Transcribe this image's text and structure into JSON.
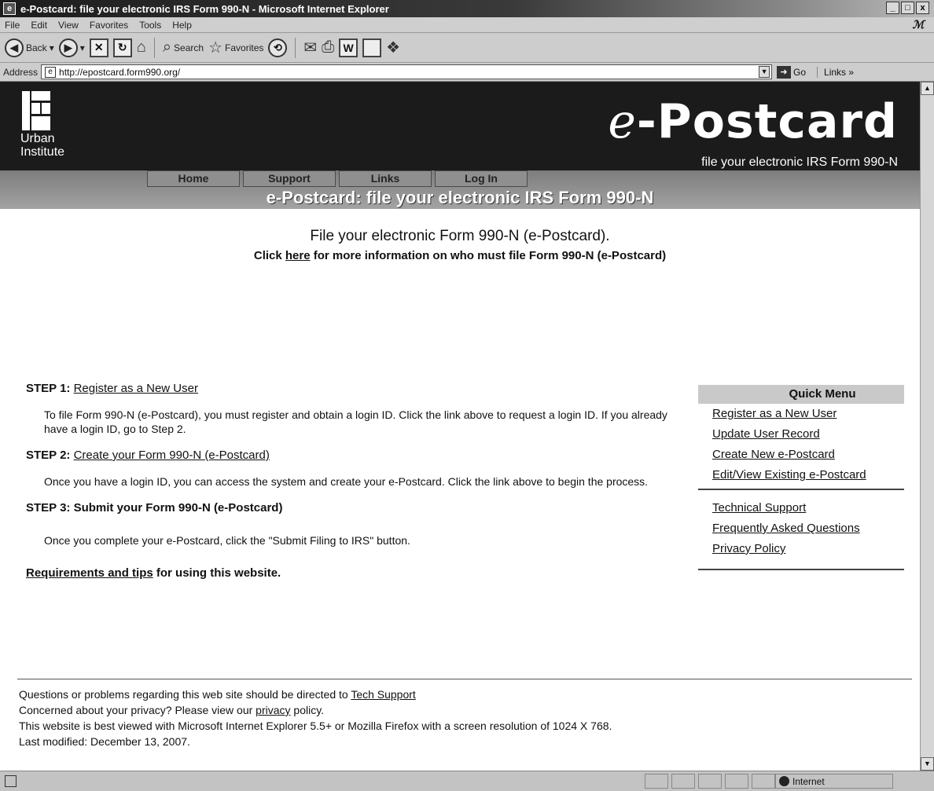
{
  "window": {
    "title": "e-Postcard: file your electronic IRS Form 990-N - Microsoft Internet Explorer",
    "controls": [
      "_",
      "□",
      "x"
    ]
  },
  "menubar": [
    "File",
    "Edit",
    "View",
    "Favorites",
    "Tools",
    "Help"
  ],
  "toolbar": {
    "back_label": "Back",
    "search_label": "Search",
    "favorites_label": "Favorites"
  },
  "addressbar": {
    "label": "Address",
    "url": "http://epostcard.form990.org/",
    "go_label": "Go",
    "links_label": "Links"
  },
  "banner": {
    "org_name_line1": "Urban",
    "org_name_line2": "Institute",
    "brand_e": "e",
    "brand_rest": "-Postcard",
    "brand_subtitle": "file your electronic IRS Form 990-N",
    "nav": [
      "Home",
      "Support",
      "Links",
      "Log In"
    ],
    "page_title": "e-Postcard: file your electronic IRS Form 990-N"
  },
  "intro": {
    "title": "File your electronic Form 990-N (e-Postcard).",
    "line_prefix": "Click ",
    "line_link": "here",
    "line_suffix": " for more information on who must file Form 990-N (e-Postcard)"
  },
  "steps": [
    {
      "head_prefix": "STEP 1: ",
      "head_link": "Register as a New User",
      "body": "To file Form 990-N (e-Postcard), you must register and obtain a login ID. Click the link above to request a login ID. If you already have a login ID, go to Step 2."
    },
    {
      "head_prefix": "STEP 2: ",
      "head_link": "Create your Form 990-N (e-Postcard)",
      "body": "Once you have a login ID, you can access the system and create your e-Postcard. Click the link above to begin the process."
    },
    {
      "head_prefix": "STEP 3: Submit your Form 990-N (e-Postcard)",
      "head_link": "",
      "body": "Once you complete your e-Postcard, click the \"Submit Filing to IRS\" button."
    }
  ],
  "requirements": {
    "link": "Requirements and tips",
    "suffix": " for using this website."
  },
  "quick_menu": {
    "title": "Quick Menu",
    "group1": [
      "Register as a New User",
      "Update User Record",
      "Create New e-Postcard",
      "Edit/View Existing e-Postcard"
    ],
    "group2": [
      "Technical Support",
      "Frequently Asked Questions",
      "Privacy Policy"
    ]
  },
  "footer": {
    "line1_prefix": "Questions or problems regarding this web site should be directed to ",
    "line1_link": "Tech Support",
    "line2_prefix": "Concerned about your privacy? Please view our ",
    "line2_link": "privacy",
    "line2_suffix": " policy.",
    "line3": "This website is best viewed with Microsoft Internet Explorer 5.5+ or Mozilla Firefox with a screen resolution of 1024 X 768.",
    "line4": "Last modified: December 13, 2007."
  },
  "statusbar": {
    "zone": "Internet"
  }
}
